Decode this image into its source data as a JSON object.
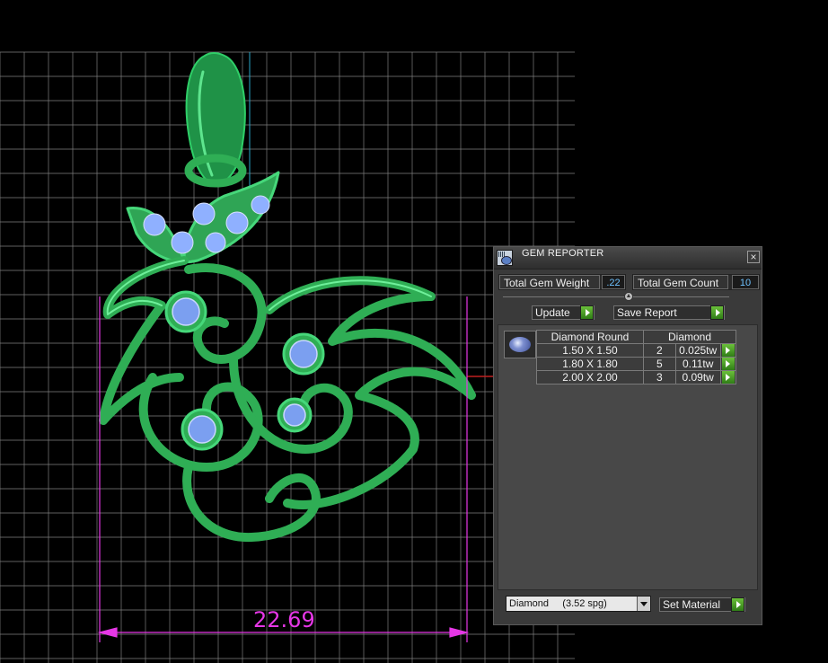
{
  "colors": {
    "background": "#000000",
    "grid": "#7f7f7f",
    "pendant": "#2fae55",
    "dimension": "#e637e6",
    "panel": "#3a3a3a",
    "accent_value": "#6fc2ff",
    "button_arrow": "#4aa42a"
  },
  "panel": {
    "title": "GEM REPORTER",
    "close_glyph": "×",
    "icon": "gem-reporter-icon"
  },
  "totals": {
    "weight_label": "Total Gem Weight",
    "weight_value": ".22",
    "count_label": "Total Gem Count",
    "count_value": "10"
  },
  "buttons": {
    "update": "Update",
    "save_report": "Save Report",
    "set_material": "Set Material"
  },
  "report": {
    "headers": [
      "Diamond Round",
      "Diamond"
    ],
    "rows": [
      {
        "size": "1.50 X 1.50",
        "count": "2",
        "weight": "0.025tw"
      },
      {
        "size": "1.80 X 1.80",
        "count": "5",
        "weight": "0.11tw"
      },
      {
        "size": "2.00 X 2.00",
        "count": "3",
        "weight": "0.09tw"
      }
    ]
  },
  "material": {
    "selected": "Diamond     (3.52 spg)"
  },
  "viewport": {
    "dimension": "22.69"
  }
}
